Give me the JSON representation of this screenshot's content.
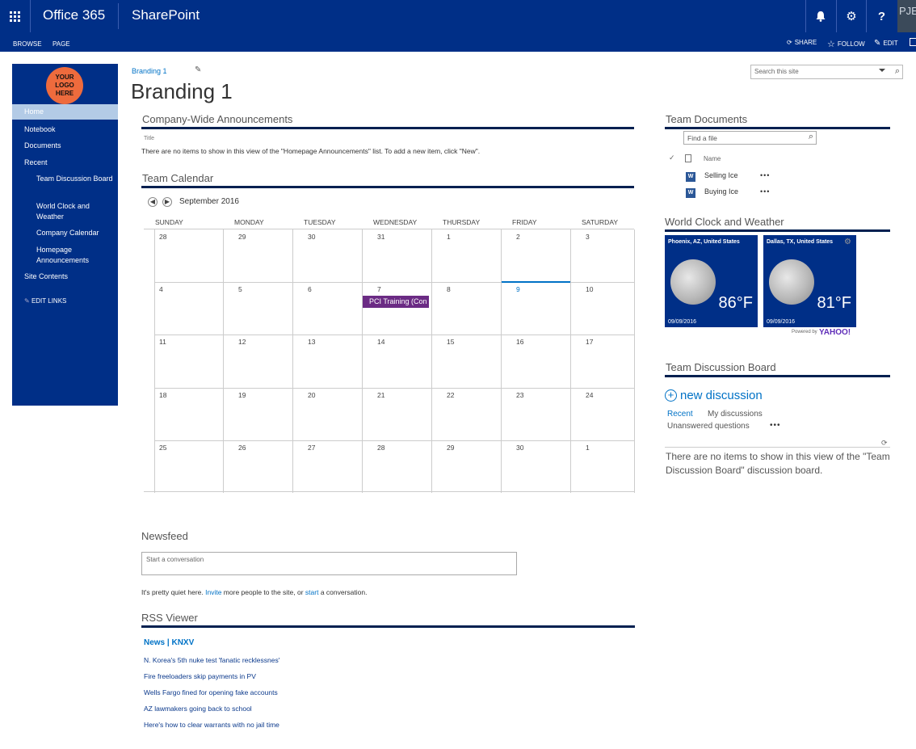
{
  "suitebar": {
    "brand": "Office 365",
    "app": "SharePoint",
    "bell_icon": "bell-icon",
    "gear_glyph": "⚙",
    "help_glyph": "?",
    "avatar_text": "PJEI"
  },
  "ribbon": {
    "browse": "BROWSE",
    "page": "PAGE",
    "share": "SHARE",
    "follow": "FOLLOW",
    "edit": "EDIT"
  },
  "nav": {
    "logo_line1": "YOUR",
    "logo_line2": "LOGO",
    "logo_line3": "HERE",
    "home": "Home",
    "notebook": "Notebook",
    "documents": "Documents",
    "recent": "Recent",
    "team_discussion": "Team Discussion Board",
    "world_clock": "World Clock and Weather",
    "company_calendar": "Company Calendar",
    "homepage_announcements": "Homepage Announcements",
    "site_contents": "Site Contents",
    "edit_links": "EDIT LINKS"
  },
  "header": {
    "breadcrumb": "Branding 1",
    "title": "Branding 1",
    "search_placeholder": "Search this site"
  },
  "announcements": {
    "title": "Company-Wide Announcements",
    "column": "Title",
    "message": "There are no items to show in this view of the \"Homepage Announcements\" list. To add a new item, click \"New\"."
  },
  "calendar": {
    "title": "Team Calendar",
    "month": "September 2016",
    "days_of_week": [
      "SUNDAY",
      "MONDAY",
      "TUESDAY",
      "WEDNESDAY",
      "THURSDAY",
      "FRIDAY",
      "SATURDAY"
    ],
    "weeks": [
      [
        "28",
        "29",
        "30",
        "31",
        "1",
        "2",
        "3"
      ],
      [
        "4",
        "5",
        "6",
        "7",
        "8",
        "9",
        "10"
      ],
      [
        "11",
        "12",
        "13",
        "14",
        "15",
        "16",
        "17"
      ],
      [
        "18",
        "19",
        "20",
        "21",
        "22",
        "23",
        "24"
      ],
      [
        "25",
        "26",
        "27",
        "28",
        "29",
        "30",
        "1"
      ]
    ],
    "today": "9",
    "event_label": "PCI Training (Con",
    "event_color": "#6b2b84"
  },
  "newsfeed": {
    "title": "Newsfeed",
    "placeholder": "Start a conversation",
    "quiet_pre": "It's pretty quiet here. ",
    "invite": "Invite",
    "quiet_mid": " more people to the site, or ",
    "start": "start",
    "quiet_post": " a conversation."
  },
  "rss": {
    "title": "RSS Viewer",
    "feed": "News | KNXV",
    "items": [
      "N. Korea's 5th nuke test 'fanatic recklessnes'",
      "Fire freeloaders skip payments in PV",
      "Wells Fargo fined for opening fake accounts",
      "AZ lawmakers going back to school",
      "Here's how to clear warrants with no jail time"
    ]
  },
  "documents": {
    "title": "Team Documents",
    "find_placeholder": "Find a file",
    "name_header": "Name",
    "files": [
      "Selling Ice",
      "Buying Ice"
    ]
  },
  "weather": {
    "title": "World Clock and Weather",
    "tiles": [
      {
        "city": "Phoenix, AZ, United States",
        "temp": "86°F",
        "date": "09/09/2016"
      },
      {
        "city": "Dallas, TX, United States",
        "temp": "81°F",
        "date": "09/09/2016"
      }
    ],
    "powered": "Powered by",
    "yahoo": "YAHOO!"
  },
  "discussion": {
    "title": "Team Discussion Board",
    "new": "new discussion",
    "recent": "Recent",
    "my": "My discussions",
    "unanswered": "Unanswered questions",
    "empty": "There are no items to show in this view of the \"Team Discussion Board\" discussion board."
  },
  "colors": {
    "brand_blue": "#002f87",
    "link_blue": "#0072c6",
    "logo_orange": "#ee6b3d"
  }
}
